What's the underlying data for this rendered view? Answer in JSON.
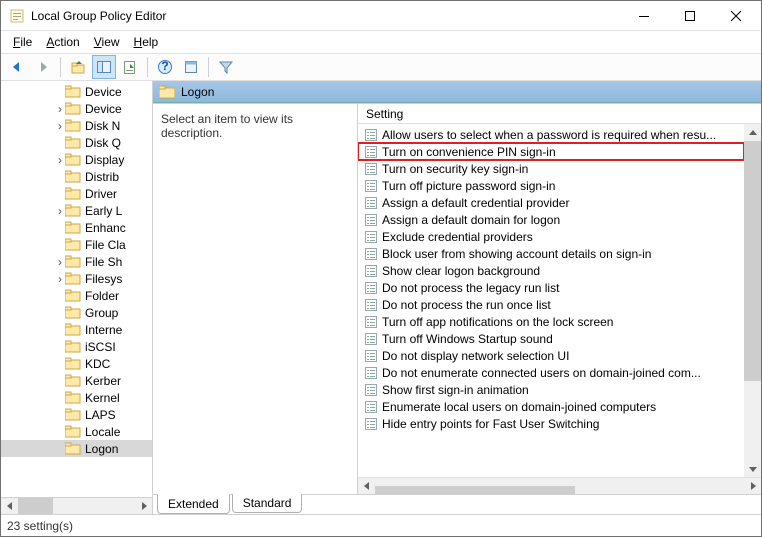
{
  "window": {
    "title": "Local Group Policy Editor"
  },
  "menu": {
    "file": "File",
    "action": "Action",
    "view": "View",
    "help": "Help"
  },
  "tree": {
    "items": [
      {
        "label": "Device",
        "exp": false
      },
      {
        "label": "Device",
        "exp": true
      },
      {
        "label": "Disk N",
        "exp": true
      },
      {
        "label": "Disk Q",
        "exp": false
      },
      {
        "label": "Display",
        "exp": true
      },
      {
        "label": "Distrib",
        "exp": false
      },
      {
        "label": "Driver",
        "exp": false
      },
      {
        "label": "Early L",
        "exp": true
      },
      {
        "label": "Enhanc",
        "exp": false
      },
      {
        "label": "File Cla",
        "exp": false
      },
      {
        "label": "File Sh",
        "exp": true
      },
      {
        "label": "Filesys",
        "exp": true
      },
      {
        "label": "Folder",
        "exp": false
      },
      {
        "label": "Group",
        "exp": false
      },
      {
        "label": "Interne",
        "exp": false
      },
      {
        "label": "iSCSI",
        "exp": false
      },
      {
        "label": "KDC",
        "exp": false
      },
      {
        "label": "Kerber",
        "exp": false
      },
      {
        "label": "Kernel",
        "exp": false
      },
      {
        "label": "LAPS",
        "exp": false
      },
      {
        "label": "Locale",
        "exp": false
      },
      {
        "label": "Logon",
        "exp": false,
        "selected": true
      }
    ]
  },
  "page": {
    "headerLabel": "Logon",
    "descPrompt": "Select an item to view its description.",
    "settingHeader": "Setting",
    "settings": [
      "Allow users to select when a password is required when resu...",
      "Turn on convenience PIN sign-in",
      "Turn on security key sign-in",
      "Turn off picture password sign-in",
      "Assign a default credential provider",
      "Assign a default domain for logon",
      "Exclude credential providers",
      "Block user from showing account details on sign-in",
      "Show clear logon background",
      "Do not process the legacy run list",
      "Do not process the run once list",
      "Turn off app notifications on the lock screen",
      "Turn off Windows Startup sound",
      "Do not display network selection UI",
      "Do not enumerate connected users on domain-joined com...",
      "Show first sign-in animation",
      "Enumerate local users on domain-joined computers",
      "Hide entry points for Fast User Switching"
    ],
    "highlightIndex": 1
  },
  "tabs": {
    "extended": "Extended",
    "standard": "Standard"
  },
  "status": "23 setting(s)"
}
